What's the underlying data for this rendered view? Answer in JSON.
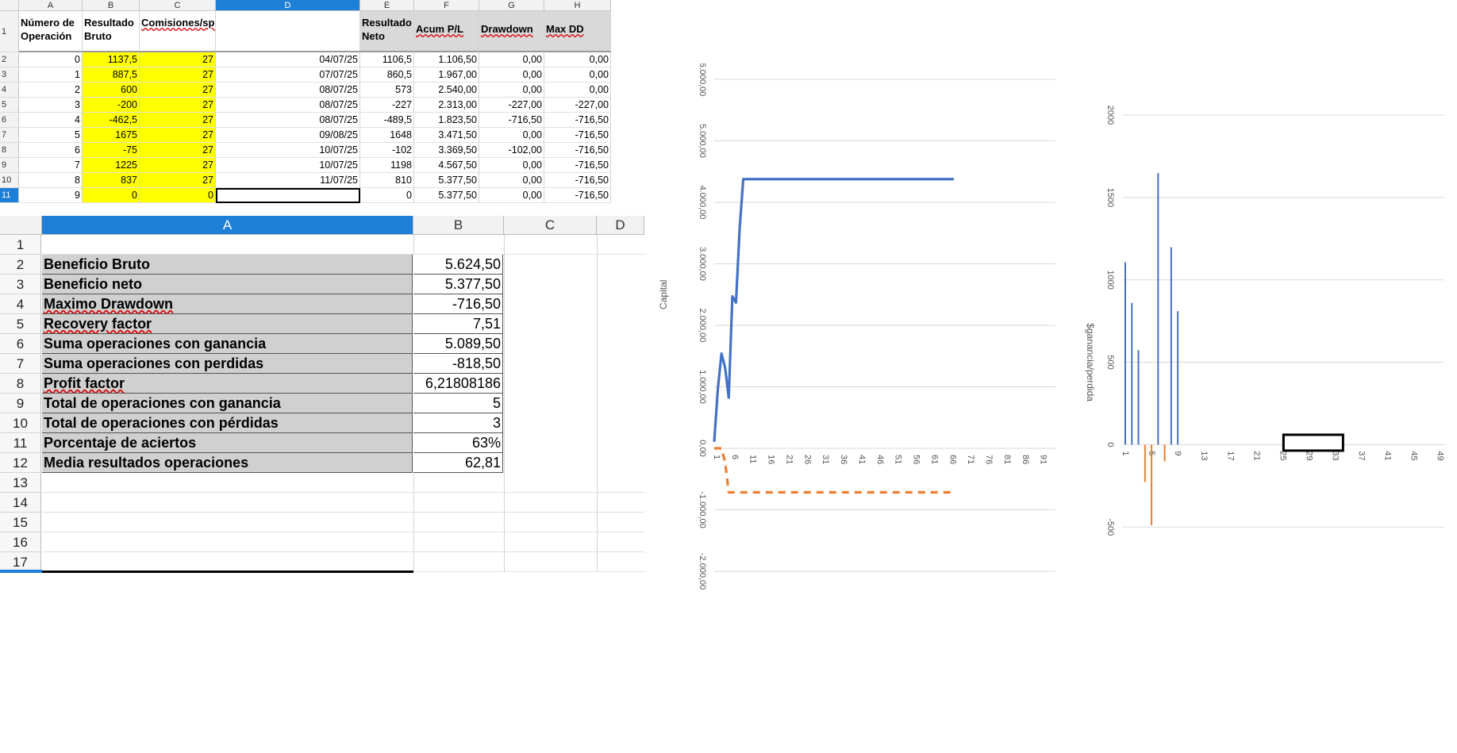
{
  "sheet1": {
    "columns": [
      "A",
      "B",
      "C",
      "D",
      "E",
      "F",
      "G",
      "H"
    ],
    "selected_column": "D",
    "header_row": {
      "row_number": "1",
      "labels": [
        "Número de Operación",
        "Resultado Bruto",
        "Comisiones/spread",
        "",
        "Resultado Neto",
        "Acum P/L",
        "Drawdown",
        "Max DD"
      ]
    },
    "rows": [
      {
        "n": "2",
        "cells": [
          "0",
          "1137,5",
          "27",
          "04/07/25",
          "1106,5",
          "1.106,50",
          "0,00",
          "0,00"
        ]
      },
      {
        "n": "3",
        "cells": [
          "1",
          "887,5",
          "27",
          "07/07/25",
          "860,5",
          "1.967,00",
          "0,00",
          "0,00"
        ]
      },
      {
        "n": "4",
        "cells": [
          "2",
          "600",
          "27",
          "08/07/25",
          "573",
          "2.540,00",
          "0,00",
          "0,00"
        ]
      },
      {
        "n": "5",
        "cells": [
          "3",
          "-200",
          "27",
          "08/07/25",
          "-227",
          "2.313,00",
          "-227,00",
          "-227,00"
        ]
      },
      {
        "n": "6",
        "cells": [
          "4",
          "-462,5",
          "27",
          "08/07/25",
          "-489,5",
          "1.823,50",
          "-716,50",
          "-716,50"
        ]
      },
      {
        "n": "7",
        "cells": [
          "5",
          "1675",
          "27",
          "09/08/25",
          "1648",
          "3.471,50",
          "0,00",
          "-716,50"
        ]
      },
      {
        "n": "8",
        "cells": [
          "6",
          "-75",
          "27",
          "10/07/25",
          "-102",
          "3.369,50",
          "-102,00",
          "-716,50"
        ]
      },
      {
        "n": "9",
        "cells": [
          "7",
          "1225",
          "27",
          "10/07/25",
          "1198",
          "4.567,50",
          "0,00",
          "-716,50"
        ]
      },
      {
        "n": "10",
        "cells": [
          "8",
          "837",
          "27",
          "11/07/25",
          "810",
          "5.377,50",
          "0,00",
          "-716,50"
        ]
      },
      {
        "n": "11",
        "cells": [
          "9",
          "0",
          "0",
          "",
          "0",
          "5.377,50",
          "0,00",
          "-716,50"
        ]
      }
    ]
  },
  "sheet2": {
    "columns": [
      "A",
      "B",
      "C",
      "D"
    ],
    "selected_column": "A",
    "rows": [
      {
        "n": "1",
        "label": "",
        "value": ""
      },
      {
        "n": "2",
        "label": "Beneficio Bruto",
        "value": "5.624,50"
      },
      {
        "n": "3",
        "label": "Beneficio neto",
        "value": "5.377,50"
      },
      {
        "n": "4",
        "label": "Maximo Drawdown",
        "value": "-716,50"
      },
      {
        "n": "5",
        "label": "Recovery factor",
        "value": "7,51"
      },
      {
        "n": "6",
        "label": "Suma operaciones con ganancia",
        "value": "5.089,50"
      },
      {
        "n": "7",
        "label": "Suma operaciones con perdidas",
        "value": "-818,50"
      },
      {
        "n": "8",
        "label": "Profit factor",
        "value": "6,21808186"
      },
      {
        "n": "9",
        "label": "Total de operaciones con ganancia",
        "value": "5"
      },
      {
        "n": "10",
        "label": "Total de operaciones con pérdidas",
        "value": "3"
      },
      {
        "n": "11",
        "label": "Porcentaje de aciertos",
        "value": "63%"
      },
      {
        "n": "12",
        "label": "Media resultados operaciones",
        "value": "62,81"
      },
      {
        "n": "13",
        "label": "",
        "value": ""
      },
      {
        "n": "14",
        "label": "",
        "value": ""
      },
      {
        "n": "15",
        "label": "",
        "value": ""
      },
      {
        "n": "16",
        "label": "",
        "value": ""
      },
      {
        "n": "17",
        "label": "",
        "value": ""
      }
    ]
  },
  "colors": {
    "selection_blue": "#1e7fd6",
    "highlight_yellow": "#ffff00",
    "label_grey": "#d0d0d0",
    "series_blue": "#4472c4",
    "series_orange": "#ed7d31"
  },
  "chart_data": [
    {
      "type": "line",
      "ylabel": "Capital",
      "ylim": [
        -2000,
        6000
      ],
      "y_ticks": [
        "6.000,00",
        "5.000,00",
        "4.000,00",
        "3.000,00",
        "2.000,00",
        "1.000,00",
        "0,00",
        "-1.000,00",
        "-2.000,00"
      ],
      "y_tick_values": [
        6000,
        5000,
        4000,
        3000,
        2000,
        1000,
        0,
        -1000,
        -2000
      ],
      "x_ticks": [
        "1",
        "6",
        "11",
        "16",
        "21",
        "26",
        "31",
        "36",
        "41",
        "46",
        "51",
        "56",
        "61",
        "66",
        "71",
        "76",
        "81",
        "86",
        "91"
      ],
      "x_range": [
        1,
        95
      ],
      "series": [
        {
          "style": "solid",
          "color": "#4472c4",
          "x": [
            1,
            2,
            3,
            4,
            5,
            6,
            7,
            8,
            9,
            10,
            67
          ],
          "y": [
            106.5,
            967,
            1540,
            1313,
            823.5,
            2471.5,
            2369.5,
            3567.5,
            4377.5,
            4377.5,
            4377.5
          ]
        },
        {
          "style": "dashed",
          "color": "#ed7d31",
          "x": [
            1,
            2,
            3,
            4,
            5,
            6,
            7,
            8,
            9,
            10,
            67
          ],
          "y": [
            0,
            0,
            0,
            -227,
            -716.5,
            -716.5,
            -716.5,
            -716.5,
            -716.5,
            -716.5,
            -716.5
          ]
        }
      ]
    },
    {
      "type": "bar",
      "ylabel": "$ganancia/perdida",
      "ylim": [
        -600,
        2000
      ],
      "y_ticks": [
        "2000",
        "1500",
        "1000",
        "500",
        "0",
        "-500"
      ],
      "y_tick_values": [
        2000,
        1500,
        1000,
        500,
        0,
        -500
      ],
      "x_ticks": [
        "1",
        "5",
        "9",
        "13",
        "17",
        "21",
        "25",
        "29",
        "33",
        "37",
        "41",
        "45",
        "49"
      ],
      "x_range": [
        1,
        50
      ],
      "series": [
        {
          "color": "#4472c4",
          "x": [
            1,
            2,
            3,
            6,
            8,
            9
          ],
          "y": [
            1106.5,
            860.5,
            573,
            1648,
            1198,
            810
          ]
        },
        {
          "color": "#ed7d31",
          "x": [
            4,
            5,
            7
          ],
          "y": [
            -227,
            -489.5,
            -102
          ]
        }
      ]
    }
  ]
}
